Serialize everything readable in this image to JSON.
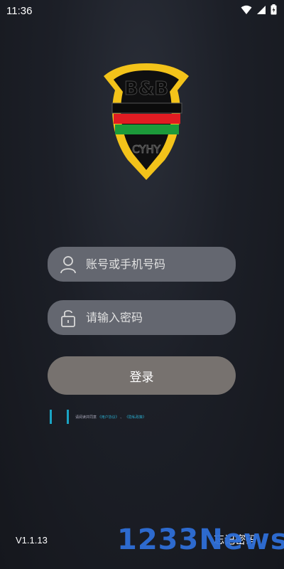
{
  "status": {
    "time": "11:36"
  },
  "logo": {
    "top_text": "B&B",
    "bottom_text": "CYHY",
    "colors": {
      "gold": "#f3c31a",
      "red": "#e01c22",
      "green": "#1c9a3a",
      "black": "#0b0b0b"
    }
  },
  "form": {
    "account_placeholder": "账号或手机号码",
    "password_placeholder": "请输入密码",
    "login_label": "登录"
  },
  "agreement": {
    "text": "请阅读并同意",
    "link1": "《用户协议》",
    "sep": "、",
    "link2": "《隐私政策》"
  },
  "footer": {
    "version": "V1.1.13",
    "forgot_label": "忘记密码"
  },
  "watermark": {
    "text": "1233News"
  },
  "colors": {
    "field_bg": "#646770",
    "button_bg": "#77726f",
    "accent": "#1aa4c4"
  }
}
